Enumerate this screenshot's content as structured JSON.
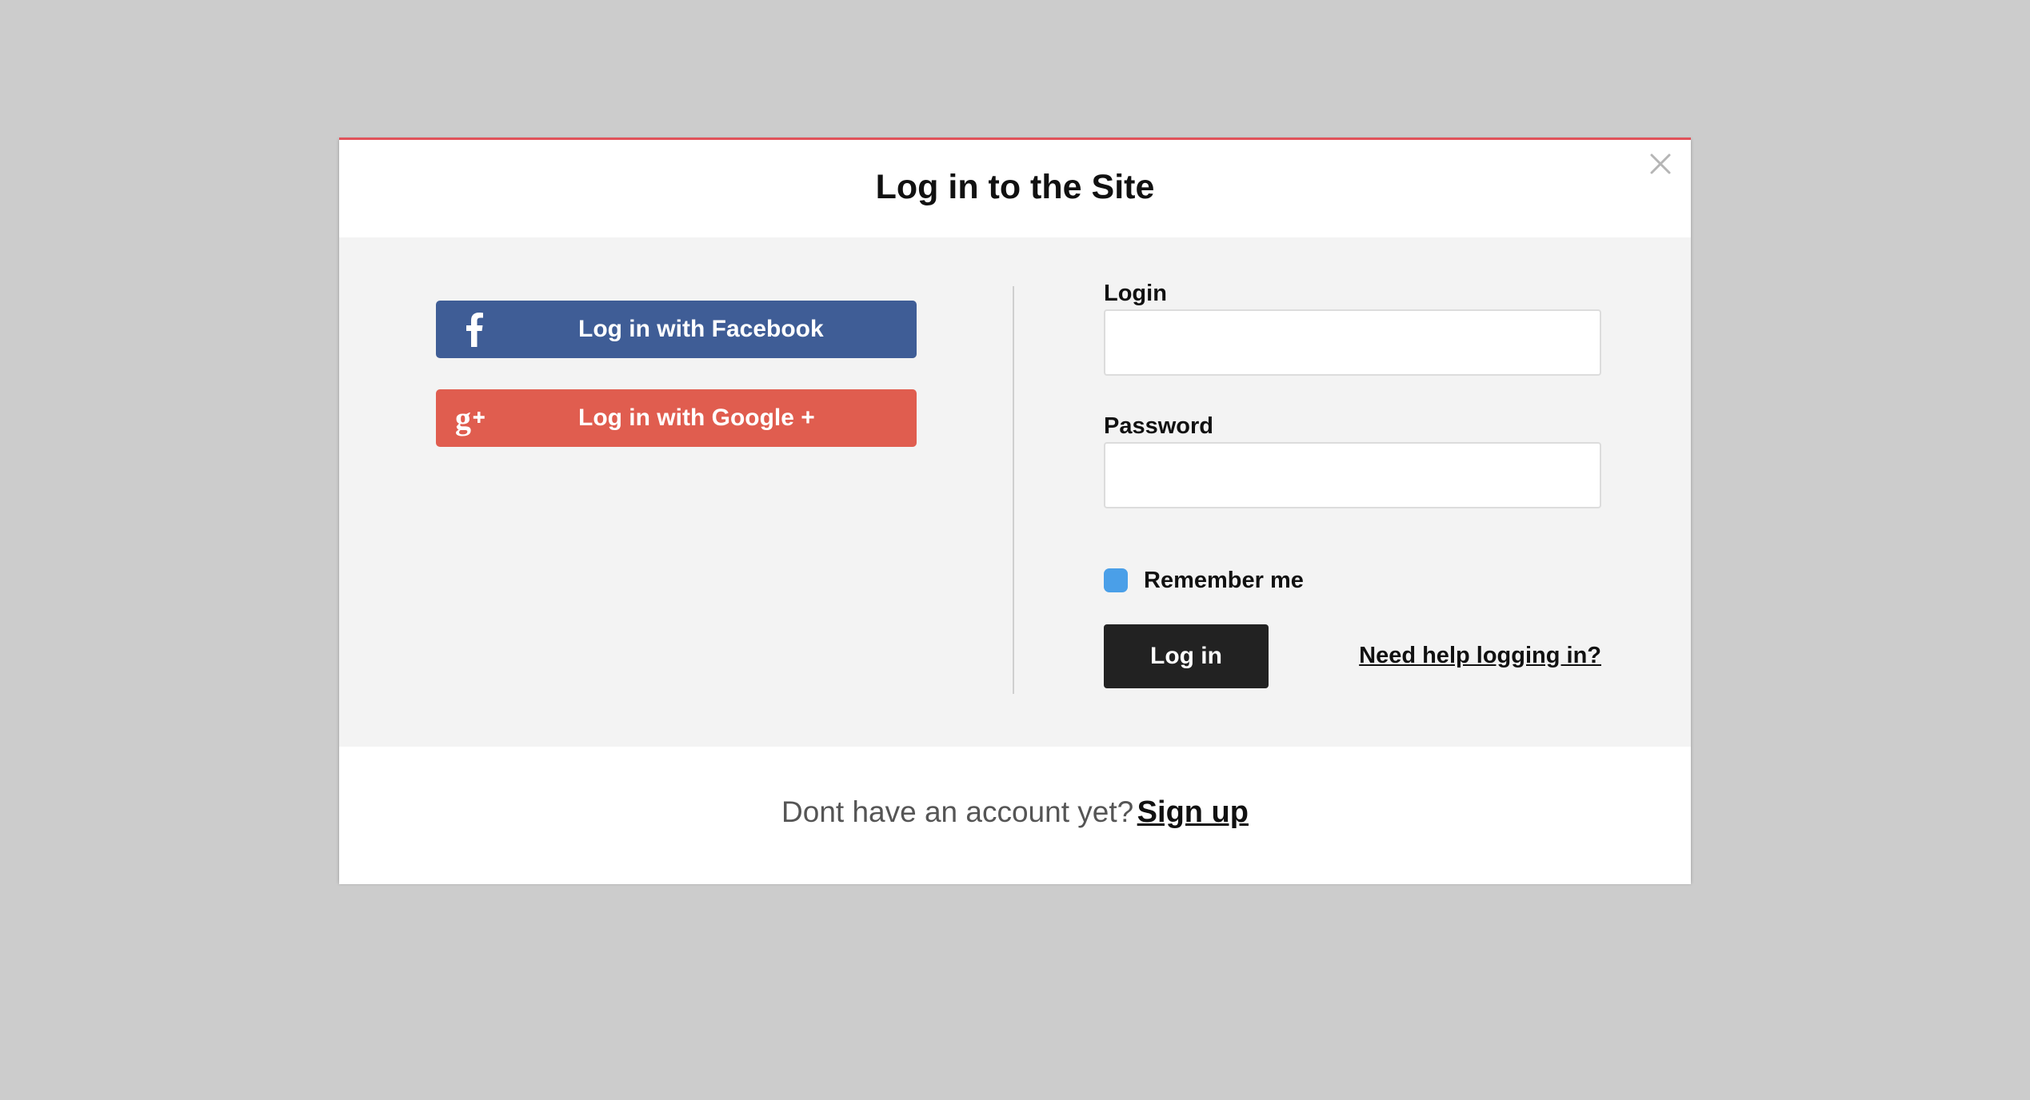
{
  "modal": {
    "title": "Log in to the Site",
    "accent_color": "#e0525a"
  },
  "close": {
    "icon": "close-icon"
  },
  "social": {
    "facebook": {
      "label": "Log in with Facebook",
      "icon": "facebook-icon",
      "color": "#3f5d96"
    },
    "google": {
      "label": "Log in with Google +",
      "icon": "google-plus-icon",
      "color": "#e05d4f"
    }
  },
  "form": {
    "login_label": "Login",
    "login_value": "",
    "login_placeholder": "",
    "password_label": "Password",
    "password_value": "",
    "password_placeholder": "",
    "remember_label": "Remember me",
    "remember_checked": true,
    "checkbox_color": "#4a9fe8",
    "submit_label": "Log in",
    "help_link": "Need help logging in?"
  },
  "footer": {
    "prompt": "Dont have an account yet?",
    "signup_link": "Sign up"
  }
}
